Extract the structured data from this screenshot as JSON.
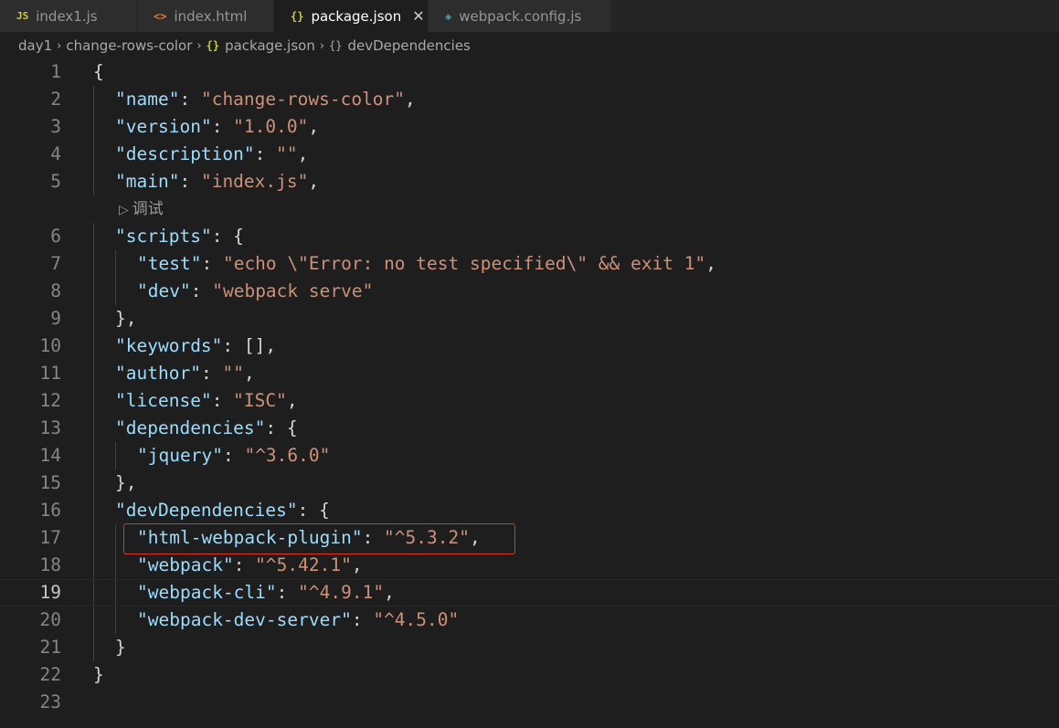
{
  "tabs": [
    {
      "icon": "JS",
      "label": "index1.js",
      "active": false
    },
    {
      "icon": "<>",
      "label": "index.html",
      "active": false
    },
    {
      "icon": "{}",
      "label": "package.json",
      "active": true,
      "close": "✕"
    },
    {
      "icon": "◈",
      "label": "webpack.config.js",
      "active": false
    }
  ],
  "breadcrumb": {
    "items": [
      "day1",
      "change-rows-color",
      "package.json",
      "devDependencies"
    ],
    "sep": "›",
    "json_icon": "{}"
  },
  "codelens": {
    "icon": "▷",
    "label": "调试"
  },
  "lines": [
    {
      "n": "1",
      "code": "{"
    },
    {
      "n": "2",
      "key": "name",
      "val": "change-rows-color",
      "tail": ","
    },
    {
      "n": "3",
      "key": "version",
      "val": "1.0.0",
      "tail": ","
    },
    {
      "n": "4",
      "key": "description",
      "val": "",
      "tail": ","
    },
    {
      "n": "5",
      "key": "main",
      "val": "index.js",
      "tail": ","
    },
    {
      "n": "6",
      "key": "scripts",
      "open": "{"
    },
    {
      "n": "7",
      "key": "test",
      "val": "echo \\\"Error: no test specified\\\" && exit 1",
      "tail": ","
    },
    {
      "n": "8",
      "key": "dev",
      "val": "webpack serve",
      "tail": ""
    },
    {
      "n": "9",
      "code": "},"
    },
    {
      "n": "10",
      "key": "keywords",
      "raw": "[],"
    },
    {
      "n": "11",
      "key": "author",
      "val": "",
      "tail": ","
    },
    {
      "n": "12",
      "key": "license",
      "val": "ISC",
      "tail": ","
    },
    {
      "n": "13",
      "key": "dependencies",
      "open": "{"
    },
    {
      "n": "14",
      "key": "jquery",
      "val": "^3.6.0",
      "tail": ""
    },
    {
      "n": "15",
      "code": "},"
    },
    {
      "n": "16",
      "key": "devDependencies",
      "open": "{"
    },
    {
      "n": "17",
      "key": "html-webpack-plugin",
      "val": "^5.3.2",
      "tail": ","
    },
    {
      "n": "18",
      "key": "webpack",
      "val": "^5.42.1",
      "tail": ","
    },
    {
      "n": "19",
      "key": "webpack-cli",
      "val": "^4.9.1",
      "tail": ","
    },
    {
      "n": "20",
      "key": "webpack-dev-server",
      "val": "^4.5.0",
      "tail": ""
    },
    {
      "n": "21",
      "code": "}"
    },
    {
      "n": "22",
      "code": "}"
    },
    {
      "n": "23",
      "code": ""
    }
  ],
  "colors": {
    "key": "#9cdcfe",
    "string": "#ce9178",
    "punct": "#d4d4d4",
    "highlight_border": "#e0342a"
  }
}
